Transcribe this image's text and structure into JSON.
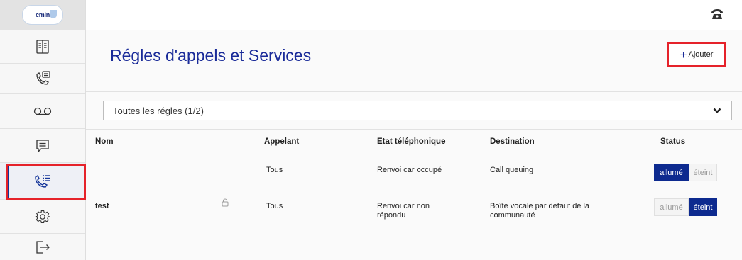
{
  "sidebar": {
    "logo_text": "cmin",
    "items": [
      {
        "name": "directory",
        "icon": "book-icon"
      },
      {
        "name": "call-history",
        "icon": "phone-list-icon"
      },
      {
        "name": "voicemail",
        "icon": "voicemail-icon"
      },
      {
        "name": "messages",
        "icon": "message-icon"
      },
      {
        "name": "call-rules",
        "icon": "call-rules-icon",
        "active": true
      },
      {
        "name": "settings",
        "icon": "gear-icon"
      },
      {
        "name": "logout",
        "icon": "logout-icon"
      }
    ]
  },
  "topbar": {
    "icon": "telephone-icon"
  },
  "header": {
    "title": "Régles d'appels et Services",
    "add_plus": "+",
    "add_label": "Ajouter"
  },
  "filter": {
    "selected": "Toutes les régles (1/2)"
  },
  "table": {
    "columns": {
      "name": "Nom",
      "caller": "Appelant",
      "phone_state": "Etat téléphonique",
      "destination": "Destination",
      "status": "Status"
    },
    "rows": [
      {
        "name": "",
        "caller": "Tous",
        "phone_state": "Renvoi car occupé",
        "destination": "Call queuing",
        "on_label": "allumé",
        "off_label": "éteint",
        "active": "on"
      },
      {
        "name": "test",
        "locked": true,
        "caller": "Tous",
        "phone_state": "Renvoi car non répondu",
        "destination": "Boîte vocale par défaut de la communauté",
        "on_label": "allumé",
        "off_label": "éteint",
        "active": "off"
      }
    ]
  },
  "colors": {
    "accent": "#1a2b99",
    "toggle_active": "#0d2a8f",
    "highlight": "#e5222a"
  }
}
